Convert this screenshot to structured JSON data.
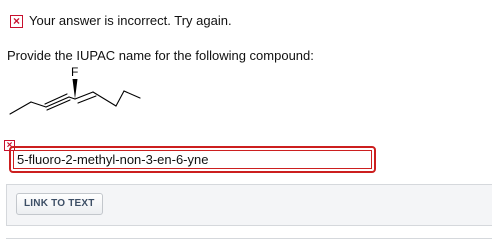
{
  "feedback": {
    "icon": "x-mark-icon",
    "text": "Your answer is incorrect.  Try again.",
    "color": "#c8102e"
  },
  "question": {
    "prompt": "Provide the IUPAC name for the following compound:"
  },
  "structure": {
    "atom_label": "F"
  },
  "answer": {
    "value": "5-fluoro-2-methyl-non-3-en-6-yne",
    "error_color": "#cc1f1f"
  },
  "panel": {
    "link_label": "LINK TO TEXT"
  }
}
